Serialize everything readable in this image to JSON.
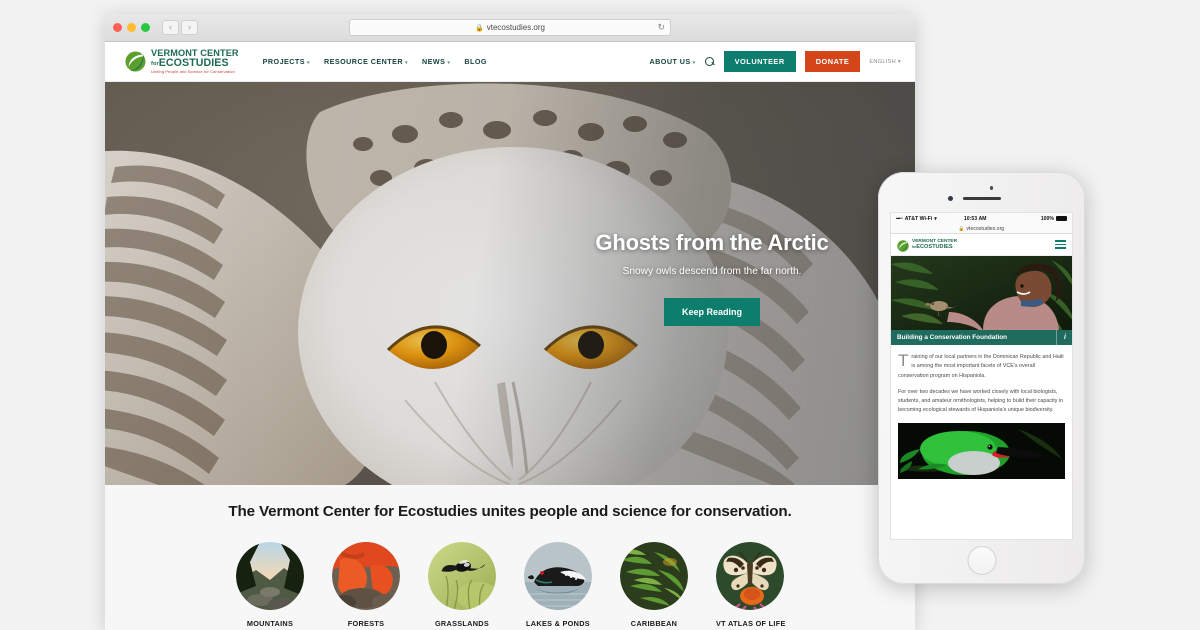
{
  "browser": {
    "traffic_lights": [
      "close",
      "minimize",
      "maximize"
    ],
    "back_label": "‹",
    "forward_label": "›",
    "lock_icon": "lock-icon",
    "url": "vtecostudies.org",
    "reload_icon": "↻"
  },
  "site": {
    "logo": {
      "line1": "VERMONT CENTER",
      "line2_small": "for",
      "line2": "ECOSTUDIES",
      "tagline": "Uniting People and Science for Conservation"
    },
    "nav": [
      {
        "label": "PROJECTS",
        "has_caret": true
      },
      {
        "label": "RESOURCE CENTER",
        "has_caret": true
      },
      {
        "label": "NEWS",
        "has_caret": true
      },
      {
        "label": "BLOG",
        "has_caret": false
      }
    ],
    "about": {
      "label": "ABOUT US",
      "caret": "▾"
    },
    "search_icon": "search-icon",
    "volunteer_label": "VOLUNTEER",
    "donate_label": "DONATE",
    "language_label": "ENGLISH",
    "language_caret": "▾"
  },
  "hero": {
    "title": "Ghosts from the Arctic",
    "subtitle": "Snowy owls descend from the far north.",
    "button_label": "Keep Reading",
    "image_subject": "snowy-owl"
  },
  "below_hero": {
    "tagline": "The Vermont Center for Ecostudies unites people and science for conservation.",
    "categories": [
      {
        "label": "MOUNTAINS",
        "subject": "mountain-forest-sunrise"
      },
      {
        "label": "FORESTS",
        "subject": "red-eft-salamander"
      },
      {
        "label": "GRASSLANDS",
        "subject": "bobolink-in-flight"
      },
      {
        "label": "LAKES & PONDS",
        "subject": "common-loon"
      },
      {
        "label": "CARIBBEAN",
        "subject": "tropical-ferns"
      },
      {
        "label": "VT ATLAS OF LIFE",
        "subject": "painted-lady-butterfly"
      }
    ]
  },
  "phone": {
    "status": {
      "signal": "▪▪▪▫▫",
      "carrier": "AT&T Wi-Fi",
      "wifi_icon": "wifi-icon",
      "time": "10:53 AM",
      "battery_percent": "100%"
    },
    "url": "vtecostudies.org",
    "lock_icon": "lock-icon",
    "logo": {
      "line1": "VERMONT CENTER",
      "line2_small": "for",
      "line2": "ECOSTUDIES"
    },
    "menu_icon": "hamburger-icon",
    "hero_image_subject": "woman-holding-bird",
    "caption": "Building a Conservation Foundation",
    "info_icon": "i",
    "paragraphs": [
      "Training of our local partners in the Dominican Republic and Haiti is among the most important facets of VCE's overall conservation program on Hispaniola.",
      "For over two decades we have worked closely with local biologists, students, and amateur ornithologists, helping to build their capacity in becoming ecological stewards of Hispaniola's unique biodiversity."
    ],
    "photo_subject": "green-broad-billed-tody"
  },
  "colors": {
    "teal": "#0d7d6e",
    "orange": "#d4461a",
    "logo_green": "#1d6b4f",
    "caption_green": "#1f6b5d",
    "page_bg": "#f2f2f2"
  }
}
